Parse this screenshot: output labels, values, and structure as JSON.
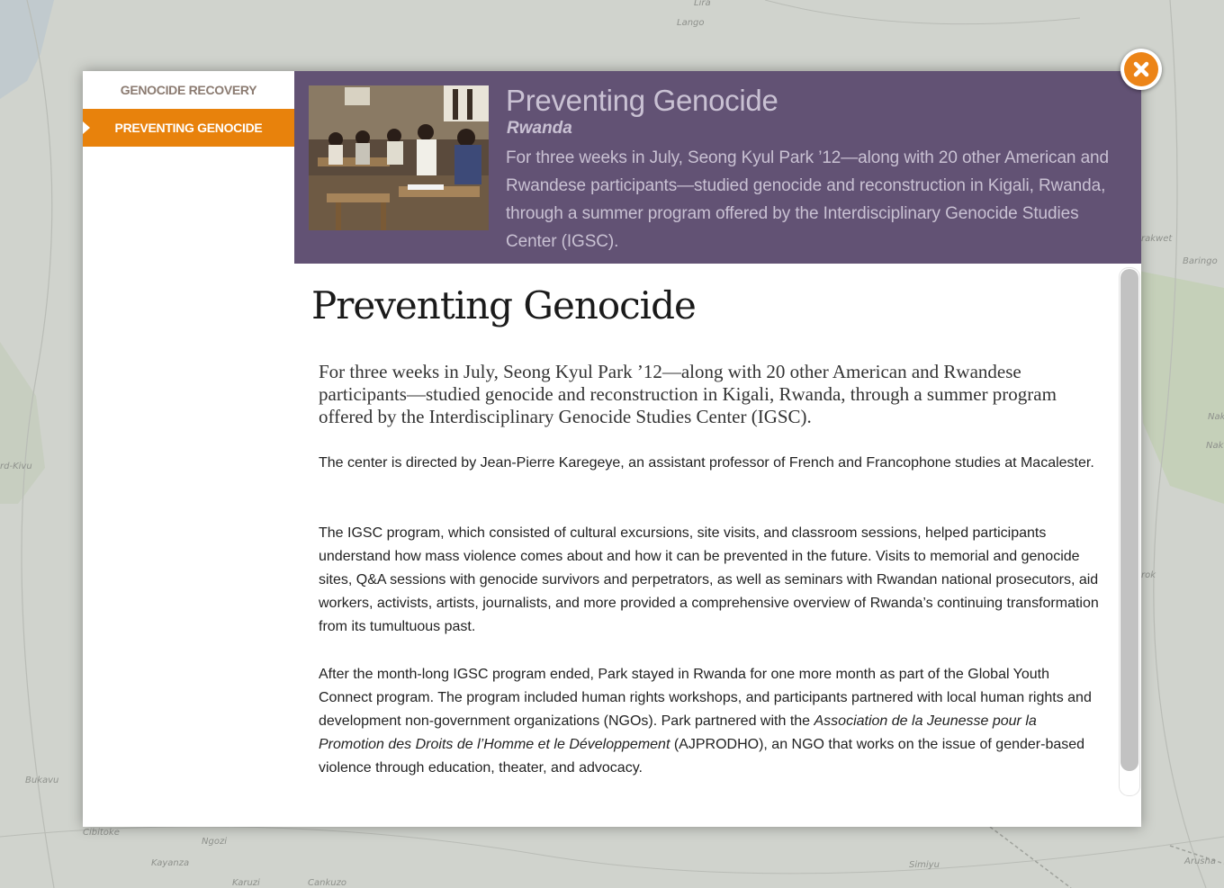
{
  "map": {
    "labels": [
      "Lira",
      "Lango",
      "rakwet",
      "Baringo",
      "Naki",
      "Nak",
      "rd-Kivu",
      "Bukavu",
      "Cibitoke",
      "Ngozi",
      "Kayanza",
      "Karuzi",
      "Cankuzo",
      "Simiyu",
      "Arusha",
      "rok"
    ]
  },
  "sidebar": {
    "items": [
      {
        "label": "GENOCIDE RECOVERY"
      },
      {
        "label": "PREVENTING GENOCIDE"
      }
    ]
  },
  "header": {
    "title": "Preventing Genocide",
    "subtitle": "Rwanda",
    "description": "For three weeks in July, Seong Kyul Park ’12—along with 20 other American and Rwandese participants—studied genocide and reconstruction in Kigali, Rwanda, through a summer program offered by the Interdisciplinary Genocide Studies Center (IGSC)."
  },
  "article": {
    "title": "Preventing Genocide",
    "lead": "For three weeks in July, Seong Kyul Park ’12—along with 20 other American and Rwandese participants—studied genocide and reconstruction in Kigali, Rwanda, through a summer program offered by the Interdisciplinary Genocide Studies Center (IGSC).",
    "p1": "The center is directed by Jean-Pierre Karegeye, an assistant professor of French and Francophone studies at Macalester.",
    "p2": "The IGSC program, which consisted of cultural excursions, site visits, and classroom sessions, helped participants understand how mass violence comes about and how it can be prevented in the future. Visits to memorial and genocide sites, Q&A sessions with genocide survivors and perpetrators, as well as seminars with Rwandan national prosecutors, aid workers, activists, artists, journalists, and more provided a comprehensive overview of Rwanda’s continuing transformation from its tumultuous past.",
    "p3_before": "After the month-long IGSC program ended, Park stayed in Rwanda for one more month as part of the Global Youth Connect program. The program included human rights workshops, and participants partnered with local human rights and development non-government organizations (NGOs). Park partnered with the ",
    "p3_italic": "Association de la Jeunesse pour la Promotion des Droits de l’Homme et le Développement",
    "p3_after": " (AJPRODHO), an NGO that works on the issue of gender-based violence through education, theater, and advocacy."
  },
  "colors": {
    "accent": "#e8820c",
    "header_bg": "#625274",
    "header_text": "#c9c1d3",
    "sidebar_text": "#8b7b71"
  },
  "icons": {
    "close": "close-x-icon"
  }
}
